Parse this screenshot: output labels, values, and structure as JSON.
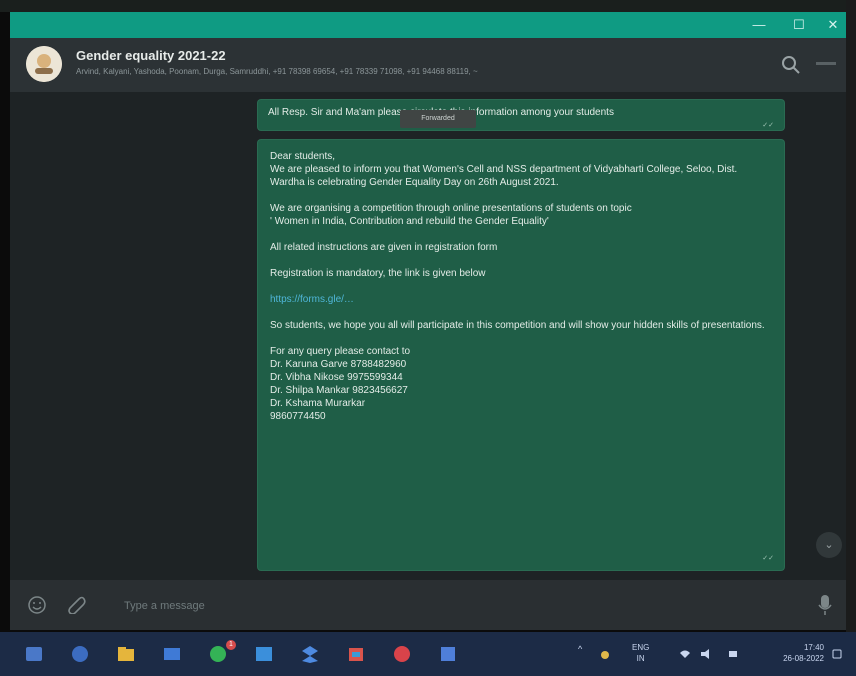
{
  "window": {
    "controls": {
      "minimize": "—",
      "maximize": "☐",
      "close": "✕"
    }
  },
  "header": {
    "title": "Gender equality 2021-22",
    "participants": "Arvind, Kalyani, Yashoda, Poonam, Durga, Samruddhi, +91 78398 69654, +91 78339 71098, +91 94468 88119, ~"
  },
  "messages": [
    {
      "text": "All Resp. Sir and Ma'am please circulate this information among your students",
      "tooltip": "Forwarded"
    },
    {
      "lines": [
        "Dear students,",
        "We are pleased to inform you that Women's Cell and NSS department of Vidyabharti College, Seloo, Dist. Wardha is celebrating Gender Equality Day on 26th August 2021.",
        "",
        "We are organising a competition through online presentations of students on topic",
        "' Women in India, Contribution and rebuild the Gender Equality'",
        "",
        "All related instructions are given in registration form",
        "",
        "Registration is mandatory, the link is given below",
        ""
      ],
      "link": "https://forms.gle/…",
      "lines_after": [
        "",
        "So students, we hope you all will participate in this competition and will show your hidden skills of presentations.",
        "",
        "For any query please contact to",
        "Dr. Karuna Garve 8788482960",
        "Dr. Vibha Nikose 9975599344",
        "Dr. Shilpa Mankar 9823456627",
        "Dr. Kshama Murarkar",
        "9860774450"
      ]
    }
  ],
  "composer": {
    "placeholder": "Type a message"
  },
  "taskbar": {
    "badge_count": "1",
    "lang_line1": "ENG",
    "lang_line2": "IN",
    "time": "17:40",
    "date": "26-08-2022"
  },
  "colors": {
    "titlebar": "#0f9b83",
    "bubble": "#1f5e47",
    "link": "#4fb6d8",
    "taskbar": "#1c2b46"
  },
  "icons": [
    "search-icon",
    "menu-icon",
    "emoji-icon",
    "attach-icon",
    "mic-icon",
    "chevron-down-icon"
  ]
}
